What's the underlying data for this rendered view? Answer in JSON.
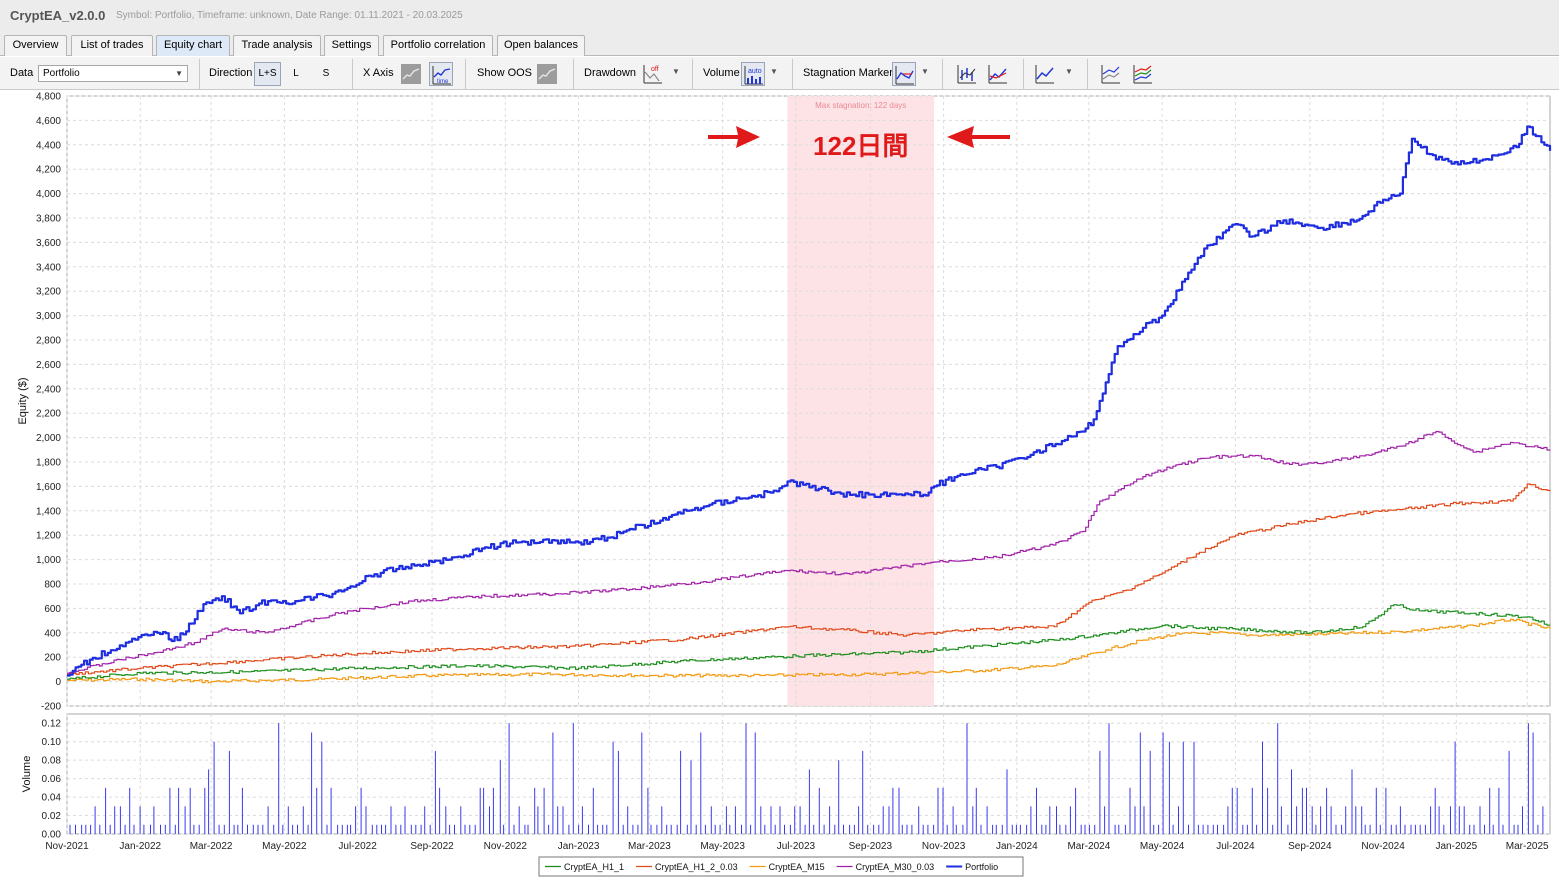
{
  "app": {
    "title": "CryptEA_v2.0.0",
    "subtitle": "Symbol: Portfolio, Timeframe: unknown, Date Range: 01.11.2021 - 20.03.2025"
  },
  "tabs": [
    {
      "label": "Overview",
      "active": false
    },
    {
      "label": "List of trades",
      "active": false
    },
    {
      "label": "Equity chart",
      "active": true
    },
    {
      "label": "Trade analysis",
      "active": false
    },
    {
      "label": "Settings",
      "active": false
    },
    {
      "label": "Portfolio correlation",
      "active": false
    },
    {
      "label": "Open balances",
      "active": false
    }
  ],
  "toolbar": {
    "data_label": "Data",
    "data_value": "Portfolio",
    "direction_label": "Direction",
    "direction_options": [
      "L+S",
      "L",
      "S"
    ],
    "direction_selected": "L+S",
    "xaxis_label": "X Axis",
    "xaxis_time_caption": "time",
    "show_oos_label": "Show OOS",
    "drawdown_label": "Drawdown",
    "drawdown_state": "off",
    "volume_label": "Volume",
    "volume_state": "auto",
    "stagnation_label": "Stagnation Marker",
    "icons": [
      "x-axis-trades-icon",
      "x-axis-time-icon",
      "show-oos-icon",
      "drawdown-icon",
      "volume-icon",
      "stagnation-marker-icon",
      "bar-chart-icon",
      "line-compare-icon",
      "line-chart-icon",
      "multi-line-icon",
      "colored-lines-icon"
    ]
  },
  "colors": {
    "CryptEA_H1_1": "#1e8f1e",
    "CryptEA_H1_2_0.03": "#e04a1a",
    "CryptEA_M15": "#f39a12",
    "CryptEA_M30_0.03": "#a020a8",
    "Portfolio": "#1f2de0",
    "stagnation_band": "#fde3e6",
    "annotation": "#e01a1a",
    "volume_bars": "#3a3af0"
  },
  "chart_data": [
    {
      "type": "line",
      "title": "",
      "ylabel": "Equity ($)",
      "xlabel": "",
      "x_ticks": [
        "Nov-2021",
        "Jan-2022",
        "Mar-2022",
        "May-2022",
        "Jul-2022",
        "Sep-2022",
        "Nov-2022",
        "Jan-2023",
        "Mar-2023",
        "May-2023",
        "Jul-2023",
        "Sep-2023",
        "Nov-2023",
        "Jan-2024",
        "Mar-2024",
        "May-2024",
        "Jul-2024",
        "Sep-2024",
        "Nov-2024",
        "Jan-2025",
        "Mar-2025"
      ],
      "x_range": [
        "2021-11-01",
        "2025-03-20"
      ],
      "ylim": [
        -200,
        4800
      ],
      "y_ticks": [
        "-200",
        "0",
        "200",
        "400",
        "600",
        "800",
        "1,000",
        "1,200",
        "1,400",
        "1,600",
        "1,800",
        "2,000",
        "2,200",
        "2,400",
        "2,600",
        "2,800",
        "3,000",
        "3,200",
        "3,400",
        "3,600",
        "3,800",
        "4,000",
        "4,200",
        "4,400",
        "4,600",
        "4,800"
      ],
      "grid": true,
      "legend_position": "bottom-center",
      "stagnation": {
        "label": "Max stagnation: 122 days",
        "start": "2023-06-24",
        "end": "2023-10-24",
        "annotation": "122日間"
      },
      "series": [
        {
          "name": "Portfolio",
          "dates": [
            "2021-11-01",
            "2021-11-20",
            "2021-12-20",
            "2022-01-15",
            "2022-02-01",
            "2022-02-25",
            "2022-03-10",
            "2022-03-25",
            "2022-04-10",
            "2022-05-10",
            "2022-06-10",
            "2022-06-25",
            "2022-07-15",
            "2022-08-10",
            "2022-09-01",
            "2022-09-15",
            "2022-10-15",
            "2022-11-10",
            "2022-12-10",
            "2023-01-01",
            "2023-01-25",
            "2023-02-10",
            "2023-03-10",
            "2023-04-01",
            "2023-04-20",
            "2023-05-15",
            "2023-06-15",
            "2023-06-24",
            "2023-07-20",
            "2023-08-15",
            "2023-09-20",
            "2023-10-15",
            "2023-10-24",
            "2023-11-15",
            "2023-12-15",
            "2024-01-15",
            "2024-02-10",
            "2024-02-25",
            "2024-03-05",
            "2024-03-25",
            "2024-04-15",
            "2024-05-01",
            "2024-05-20",
            "2024-06-05",
            "2024-07-01",
            "2024-07-15",
            "2024-08-10",
            "2024-09-10",
            "2024-10-10",
            "2024-11-01",
            "2024-11-15",
            "2024-11-25",
            "2024-12-15",
            "2025-01-10",
            "2025-02-05",
            "2025-02-20",
            "2025-03-01",
            "2025-03-20"
          ],
          "values": [
            50,
            180,
            320,
            400,
            340,
            650,
            700,
            560,
            640,
            660,
            720,
            780,
            880,
            940,
            980,
            1000,
            1100,
            1140,
            1160,
            1140,
            1180,
            1240,
            1320,
            1400,
            1450,
            1500,
            1560,
            1640,
            1580,
            1530,
            1540,
            1530,
            1600,
            1700,
            1760,
            1880,
            1980,
            2050,
            2150,
            2750,
            2900,
            3000,
            3300,
            3550,
            3750,
            3650,
            3780,
            3720,
            3780,
            3950,
            4000,
            4450,
            4280,
            4250,
            4320,
            4380,
            4550,
            4350
          ]
        },
        {
          "name": "CryptEA_M30_0.03",
          "dates": [
            "2021-11-01",
            "2021-12-15",
            "2022-01-15",
            "2022-02-15",
            "2022-03-10",
            "2022-04-15",
            "2022-06-15",
            "2022-08-15",
            "2022-10-15",
            "2022-12-15",
            "2023-02-15",
            "2023-04-15",
            "2023-06-24",
            "2023-08-15",
            "2023-10-24",
            "2023-12-15",
            "2024-01-31",
            "2024-02-25",
            "2024-03-10",
            "2024-04-15",
            "2024-05-15",
            "2024-06-10",
            "2024-07-15",
            "2024-08-15",
            "2024-09-15",
            "2024-10-15",
            "2024-11-15",
            "2024-12-15",
            "2025-01-15",
            "2025-02-15",
            "2025-03-20"
          ],
          "values": [
            70,
            180,
            240,
            320,
            430,
            400,
            560,
            660,
            700,
            720,
            760,
            820,
            910,
            880,
            980,
            1020,
            1120,
            1230,
            1480,
            1680,
            1780,
            1840,
            1850,
            1780,
            1800,
            1850,
            1930,
            2050,
            1880,
            1960,
            1900
          ]
        },
        {
          "name": "CryptEA_H1_2_0.03",
          "dates": [
            "2021-11-01",
            "2022-01-01",
            "2022-04-01",
            "2022-07-01",
            "2022-10-01",
            "2023-01-01",
            "2023-04-01",
            "2023-06-24",
            "2023-08-15",
            "2023-10-01",
            "2023-12-01",
            "2024-02-01",
            "2024-03-01",
            "2024-04-01",
            "2024-05-01",
            "2024-06-01",
            "2024-07-01",
            "2024-08-15",
            "2024-10-01",
            "2024-11-15",
            "2025-01-01",
            "2025-02-15",
            "2025-03-01",
            "2025-03-20"
          ],
          "values": [
            60,
            110,
            170,
            230,
            270,
            290,
            350,
            450,
            420,
            380,
            430,
            450,
            650,
            750,
            890,
            1060,
            1200,
            1290,
            1370,
            1410,
            1460,
            1480,
            1620,
            1560
          ]
        },
        {
          "name": "CryptEA_H1_1",
          "dates": [
            "2021-11-01",
            "2022-01-01",
            "2022-04-01",
            "2022-07-01",
            "2022-10-01",
            "2023-01-01",
            "2023-04-01",
            "2023-07-01",
            "2023-10-01",
            "2023-12-01",
            "2024-02-01",
            "2024-03-15",
            "2024-05-01",
            "2024-06-01",
            "2024-07-01",
            "2024-09-01",
            "2024-10-15",
            "2024-11-10",
            "2024-12-01",
            "2025-01-15",
            "2025-03-01",
            "2025-03-20"
          ],
          "values": [
            20,
            70,
            80,
            110,
            130,
            110,
            170,
            210,
            240,
            290,
            340,
            390,
            460,
            440,
            430,
            400,
            450,
            630,
            580,
            560,
            530,
            460
          ]
        },
        {
          "name": "CryptEA_M15",
          "dates": [
            "2021-11-01",
            "2022-01-01",
            "2022-03-01",
            "2022-06-01",
            "2022-09-01",
            "2022-12-01",
            "2023-03-01",
            "2023-06-01",
            "2023-09-01",
            "2023-12-01",
            "2024-02-01",
            "2024-03-15",
            "2024-04-15",
            "2024-05-15",
            "2024-06-15",
            "2024-07-15",
            "2024-09-15",
            "2024-11-15",
            "2025-01-15",
            "2025-02-15",
            "2025-03-20"
          ],
          "values": [
            10,
            20,
            0,
            20,
            50,
            60,
            50,
            50,
            60,
            90,
            130,
            260,
            340,
            390,
            400,
            380,
            390,
            410,
            460,
            510,
            430
          ]
        }
      ]
    },
    {
      "type": "bar",
      "title": "",
      "ylabel": "Volume",
      "ylim": [
        0,
        0.13
      ],
      "y_ticks": [
        "0.00",
        "0.02",
        "0.04",
        "0.06",
        "0.08",
        "0.10",
        "0.12"
      ],
      "grid": true,
      "values_note": "",
      "bar_count": 300,
      "levels": [
        0.01,
        0.03,
        0.05,
        0.07,
        0.08,
        0.09,
        0.1,
        0.11,
        0.12,
        0.13
      ]
    }
  ]
}
